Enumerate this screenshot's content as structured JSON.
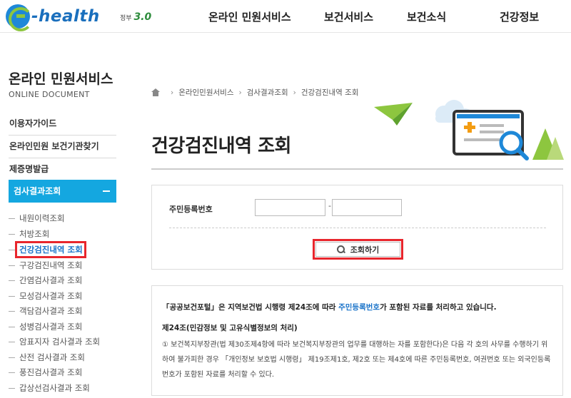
{
  "header": {
    "logo_text": "-health",
    "gov_logo_label": "정부",
    "gov_logo_mark": "3.0",
    "nav": [
      {
        "label": "온라인 민원서비스"
      },
      {
        "label": "보건서비스"
      },
      {
        "label": "보건소식"
      },
      {
        "label": "건강정보"
      }
    ]
  },
  "sidebar": {
    "title": "온라인 민원서비스",
    "subtitle": "ONLINE DOCUMENT",
    "menus": [
      {
        "label": "이용자가이드"
      },
      {
        "label": "온라인민원 보건기관찾기"
      },
      {
        "label": "제증명발급"
      },
      {
        "label": "검사결과조회"
      }
    ],
    "sub_items": [
      {
        "label": "내원이력조회"
      },
      {
        "label": "처방조회"
      },
      {
        "label": "건강검진내역 조회"
      },
      {
        "label": "구강검진내역 조회"
      },
      {
        "label": "간염검사결과 조회"
      },
      {
        "label": "모성검사결과 조회"
      },
      {
        "label": "객담검사결과 조회"
      },
      {
        "label": "성병검사결과 조회"
      },
      {
        "label": "암표지자 검사결과 조회"
      },
      {
        "label": "산전 검사결과 조회"
      },
      {
        "label": "풍진검사결과 조회"
      },
      {
        "label": "갑상선검사결과 조회"
      }
    ]
  },
  "breadcrumb": [
    "온라인민원서비스",
    "검사결과조회",
    "건강검진내역 조회"
  ],
  "page_title": "건강검진내역 조회",
  "form": {
    "label": "주민등록번호",
    "separator": "-",
    "jumin_front_value": "",
    "jumin_back_value": "",
    "search_button": "조회하기"
  },
  "notice": {
    "line1_pre": "「공공보건포털」은 지역보건법 시행령 제24조에 따라 ",
    "line1_highlight": "주민등록번호",
    "line1_post": "가 포함된 자료를 처리하고 있습니다.",
    "head": "제24조(민감정보 및 고유식별정보의 처리)",
    "body": "① 보건복지부장관(법 제30조제4항에 따라 보건복지부장관의 업무를 대행하는 자를 포함한다)은 다음 각 호의 사무를 수행하기 위하여 불가피한 경우 「개인정보 보호법 시행령」 제19조제1호, 제2호 또는 제4호에 따른 주민등록번호, 여권번호 또는 외국인등록번호가 포함된 자료를 처리할 수 있다."
  },
  "colors": {
    "accent_blue": "#14a7e0",
    "link_blue": "#1a73c9",
    "highlight_red": "#e8262d",
    "logo_blue": "#1a6fbd",
    "logo_green": "#8dc63f"
  }
}
